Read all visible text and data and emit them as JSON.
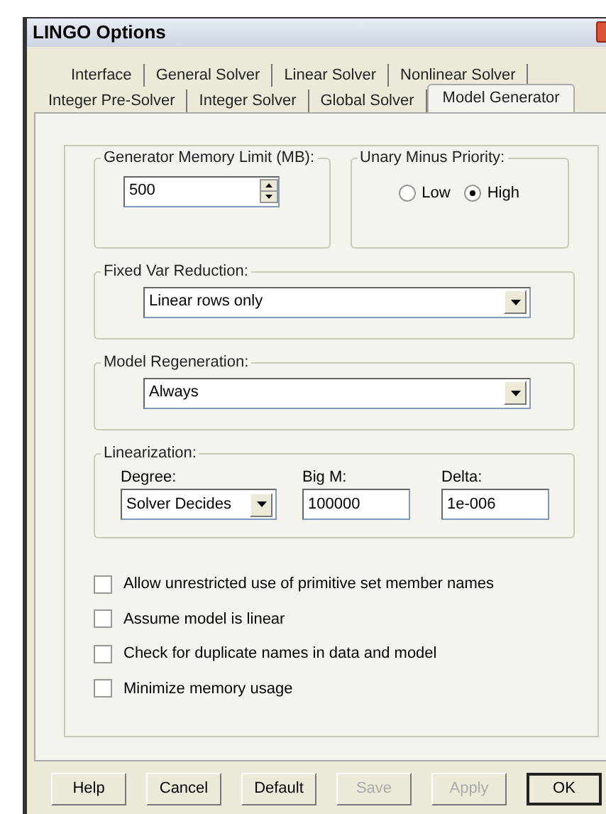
{
  "window": {
    "title": "LINGO Options"
  },
  "tab_rows": [
    {
      "tabs": [
        {
          "label": "Interface",
          "selected": false
        },
        {
          "label": "General Solver",
          "selected": false
        },
        {
          "label": "Linear Solver",
          "selected": false
        },
        {
          "label": "Nonlinear Solver",
          "selected": false
        }
      ]
    },
    {
      "tabs": [
        {
          "label": "Integer Pre-Solver",
          "selected": false
        },
        {
          "label": "Integer Solver",
          "selected": false
        },
        {
          "label": "Global Solver",
          "selected": false
        },
        {
          "label": "Model Generator",
          "selected": true
        }
      ]
    }
  ],
  "memory_limit": {
    "label": "Generator Memory Limit (MB):",
    "value": "500"
  },
  "unary_minus": {
    "label": "Unary Minus Priority:",
    "options": [
      {
        "label": "Low",
        "selected": false
      },
      {
        "label": "High",
        "selected": true
      }
    ]
  },
  "fixed_var_reduction": {
    "label": "Fixed Var Reduction:",
    "value": "Linear rows only"
  },
  "model_regeneration": {
    "label": "Model Regeneration:",
    "value": "Always"
  },
  "linearization": {
    "label": "Linearization:",
    "degree": {
      "label": "Degree:",
      "value": "Solver Decides"
    },
    "big_m": {
      "label": "Big M:",
      "value": "100000"
    },
    "delta": {
      "label": "Delta:",
      "value": "1e-006"
    }
  },
  "checkboxes": [
    {
      "label": "Allow unrestricted use of primitive set member names",
      "checked": false
    },
    {
      "label": "Assume model is linear",
      "checked": false
    },
    {
      "label": "Check for duplicate names in data and model",
      "checked": false
    },
    {
      "label": "Minimize memory usage",
      "checked": false
    }
  ],
  "buttons": [
    {
      "label": "Help",
      "disabled": false,
      "default": false
    },
    {
      "label": "Cancel",
      "disabled": false,
      "default": false
    },
    {
      "label": "Default",
      "disabled": false,
      "default": false
    },
    {
      "label": "Save",
      "disabled": true,
      "default": false
    },
    {
      "label": "Apply",
      "disabled": true,
      "default": false
    },
    {
      "label": "OK",
      "disabled": false,
      "default": true
    }
  ]
}
